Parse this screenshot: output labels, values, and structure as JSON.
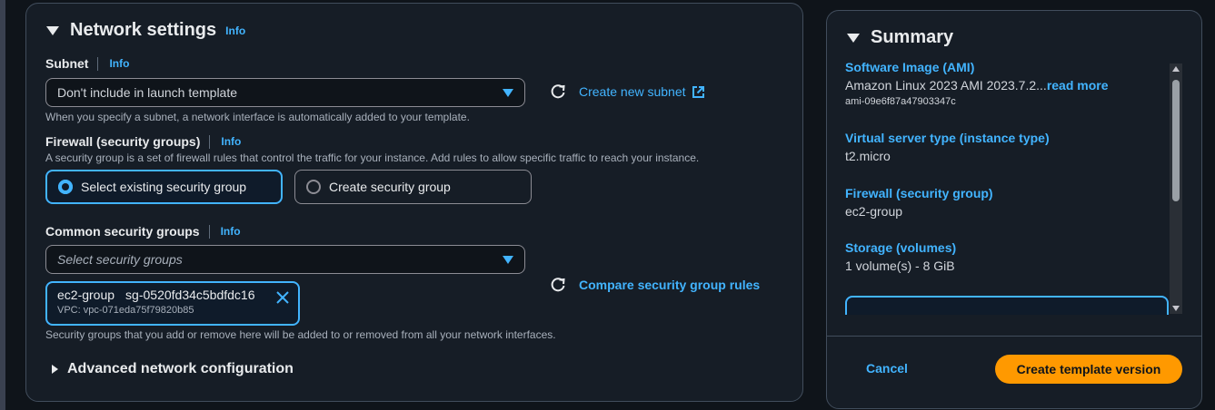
{
  "network": {
    "title": "Network settings",
    "title_info": "Info",
    "subnet": {
      "label": "Subnet",
      "info": "Info",
      "value": "Don't include in launch template",
      "create_link": "Create new subnet",
      "help": "When you specify a subnet, a network interface is automatically added to your template."
    },
    "firewall": {
      "label": "Firewall (security groups)",
      "info": "Info",
      "help": "A security group is a set of firewall rules that control the traffic for your instance. Add rules to allow specific traffic to reach your instance.",
      "option_existing": "Select existing security group",
      "option_create": "Create security group"
    },
    "common_sg": {
      "label": "Common security groups",
      "info": "Info",
      "placeholder": "Select security groups",
      "compare_link": "Compare security group rules",
      "token_name": "ec2-group",
      "token_id": "sg-0520fd34c5bdfdc16",
      "token_vpc": "VPC: vpc-071eda75f79820b85",
      "help": "Security groups that you add or remove here will be added to or removed from all your network interfaces."
    },
    "advanced": "Advanced network configuration"
  },
  "summary": {
    "title": "Summary",
    "ami_label": "Software Image (AMI)",
    "ami_value": "Amazon Linux 2023 AMI 2023.7.2...",
    "ami_readmore": "read more",
    "ami_id": "ami-09e6f87a47903347c",
    "instance_label": "Virtual server type (instance type)",
    "instance_value": "t2.micro",
    "firewall_label": "Firewall (security group)",
    "firewall_value": "ec2-group",
    "storage_label": "Storage (volumes)",
    "storage_value": "1 volume(s) - 8 GiB",
    "cancel": "Cancel",
    "create": "Create template version"
  },
  "colors": {
    "accent": "#42b4ff",
    "primary": "#ff9900",
    "panel": "#161d26",
    "background": "#0f141a"
  }
}
